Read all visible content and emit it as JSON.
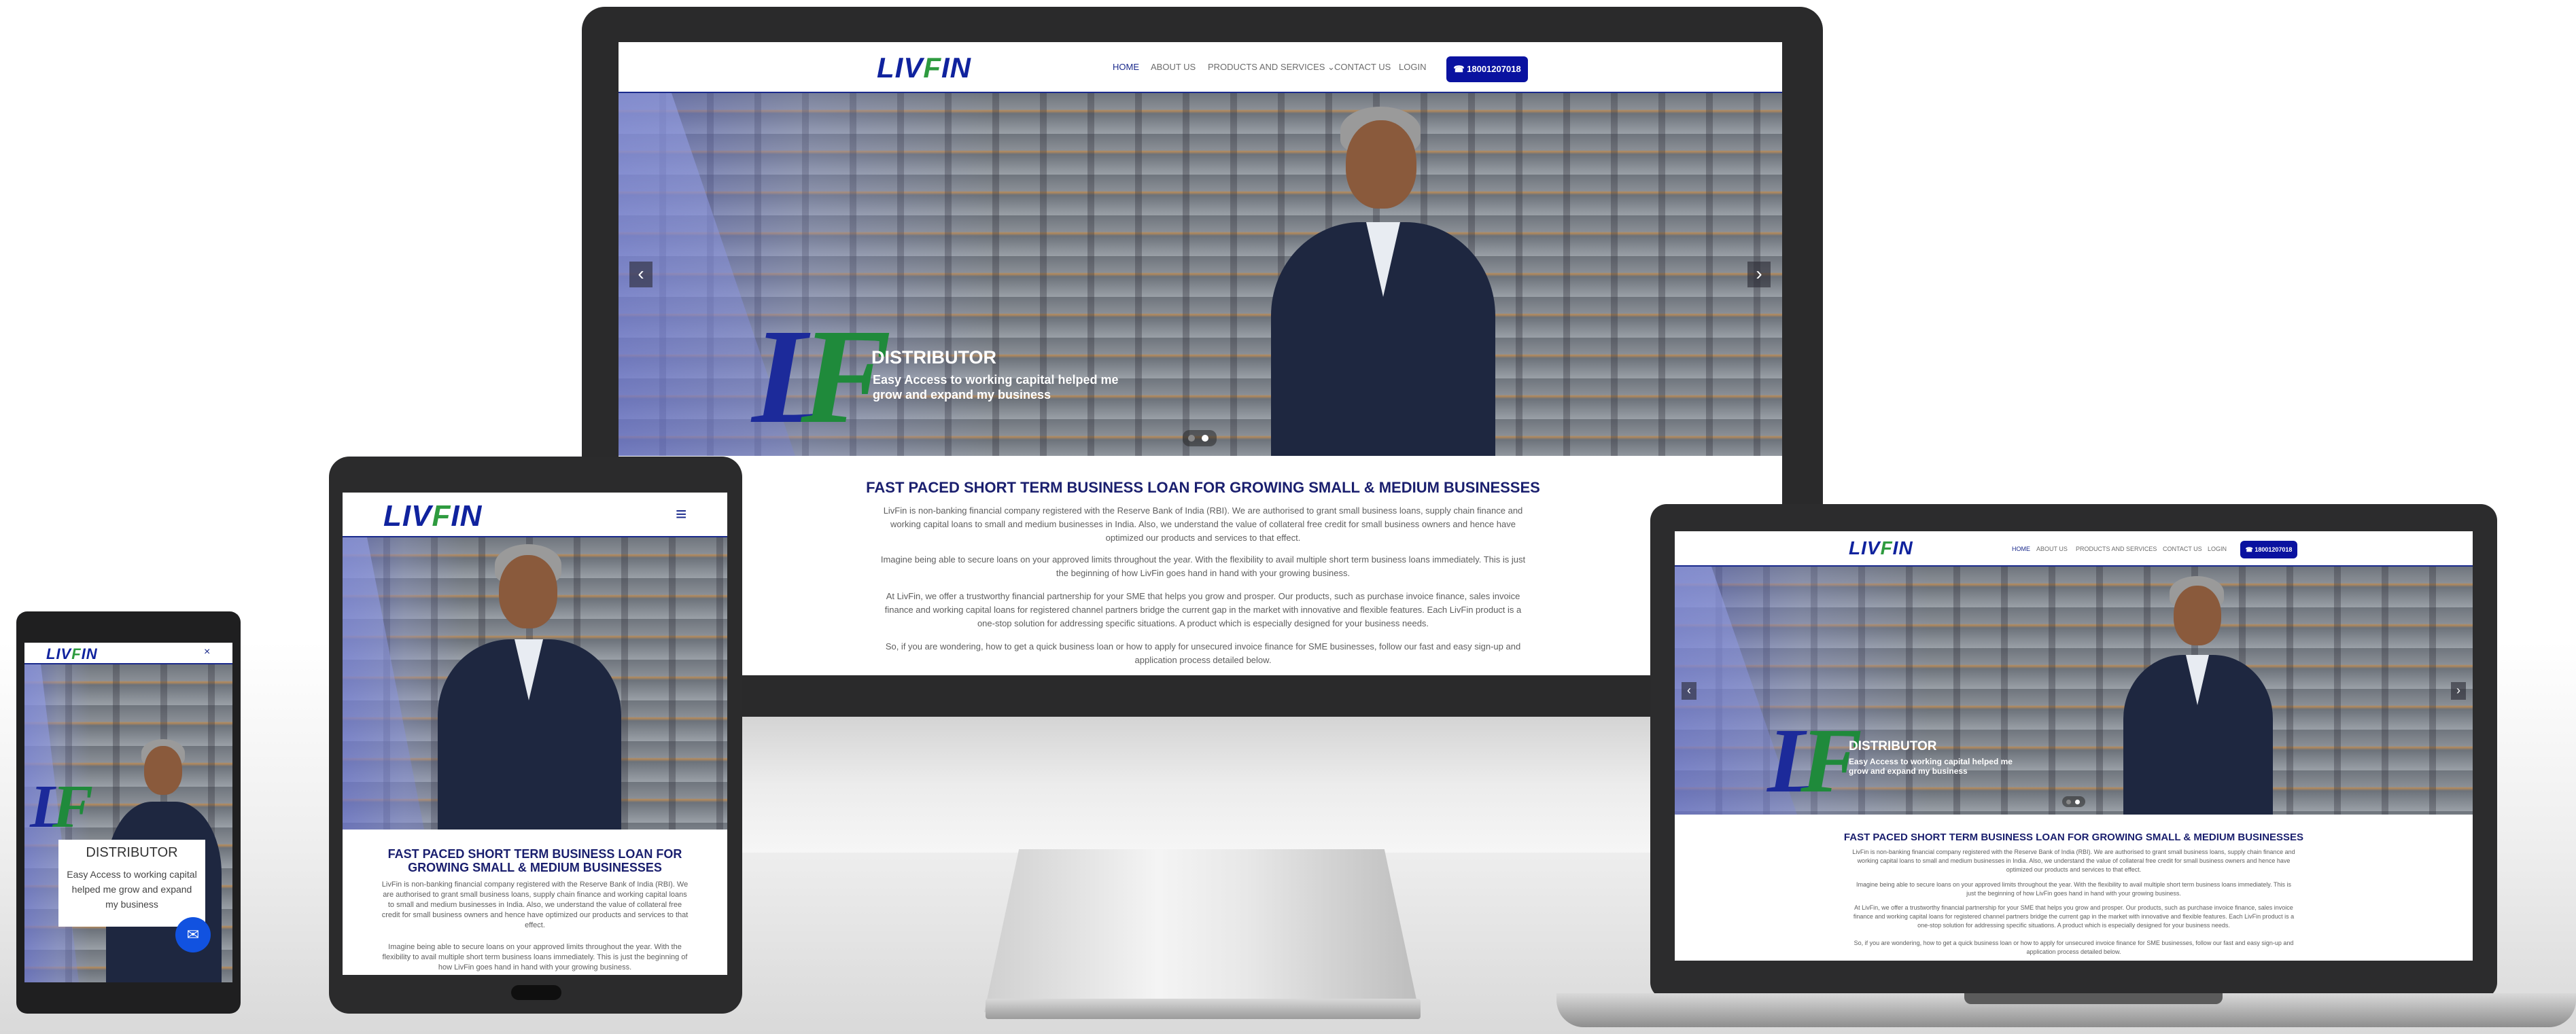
{
  "site": {
    "logo_prefix": "LIV",
    "logo_i": "F",
    "logo_suffix": "IN",
    "nav": {
      "home": "HOME",
      "about": "ABOUT US",
      "products": "PRODUCTS AND SERVICES",
      "contact": "CONTACT US",
      "login": "LOGIN",
      "phone": "18001207018"
    },
    "slide": {
      "title": "DISTRIBUTOR",
      "subtitle": "Easy Access to working capital helped me grow and expand my business"
    },
    "content": {
      "title": "FAST PACED SHORT TERM BUSINESS LOAN FOR GROWING SMALL & MEDIUM BUSINESSES",
      "p1": "LivFin is non-banking financial company registered with the Reserve Bank of India (RBI). We are authorised to grant small business loans, supply chain finance and working capital loans to small and medium businesses in India. Also, we understand the value of collateral free credit for small business owners and hence have optimized our products and services to that effect.",
      "p2": "Imagine being able to secure loans on your approved limits throughout the year. With the flexibility to avail multiple short term business loans immediately. This is just the beginning of how LivFin goes hand in hand with your growing business.",
      "p3": "At LivFin, we offer a trustworthy financial partnership for your SME that helps you grow and prosper. Our products, such as purchase invoice finance, sales invoice finance and working capital loans for registered channel partners bridge the current gap in the market with innovative and flexible features. Each LivFin product is a one-stop solution for addressing specific situations. A product which is especially designed for your business needs.",
      "p4": "So, if you are wondering, how to get a quick business loan or how to apply for unsecured invoice finance for SME businesses, follow our fast and easy sign-up and application process detailed below."
    }
  },
  "icons": {
    "phone": "☎",
    "prev": "‹",
    "next": "›",
    "burger": "≡",
    "close": "×",
    "chat": "✉",
    "chevron": "⌄"
  },
  "colors": {
    "brand_blue": "#10239e",
    "brand_green": "#2e9b3f",
    "button_blue": "#0a12a0",
    "title_navy": "#1a1f6e"
  }
}
